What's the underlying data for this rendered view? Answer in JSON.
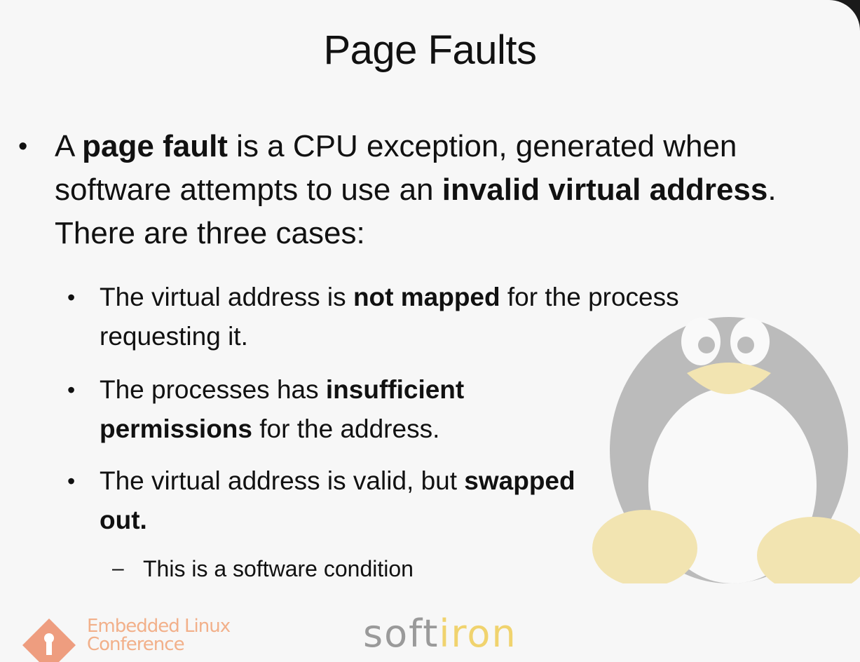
{
  "slide": {
    "title": "Page Faults",
    "main_bullet": {
      "parts": [
        {
          "text": "A ",
          "bold": false
        },
        {
          "text": "page fault",
          "bold": true
        },
        {
          "text": " is a CPU exception, generated when software attempts to use an ",
          "bold": false
        },
        {
          "text": "invalid virtual address",
          "bold": true
        },
        {
          "text": ". There are three cases:",
          "bold": false
        }
      ]
    },
    "sub_bullets": [
      {
        "parts": [
          {
            "text": "The virtual address is ",
            "bold": false
          },
          {
            "text": "not mapped",
            "bold": true
          },
          {
            "text": " for the process requesting it.",
            "bold": false
          }
        ]
      },
      {
        "parts": [
          {
            "text": "The processes has ",
            "bold": false
          },
          {
            "text": "insufficient permissions",
            "bold": true
          },
          {
            "text": " for the address.",
            "bold": false
          }
        ]
      },
      {
        "parts": [
          {
            "text": "The virtual address is valid, but ",
            "bold": false
          },
          {
            "text": "swapped out.",
            "bold": true
          }
        ]
      }
    ],
    "sub_sub_bullet": {
      "marker": "–",
      "text": "This is a software condition"
    },
    "bullet_marker": "•"
  },
  "footer": {
    "elc_line1": "Embedded Linux",
    "elc_line2": "Conference",
    "softiron_soft": "soft",
    "softiron_iron": "iron",
    "elc_color": "#e8541e",
    "iron_color": "#f0d36e"
  },
  "background_icon": "tux-penguin-watermark"
}
